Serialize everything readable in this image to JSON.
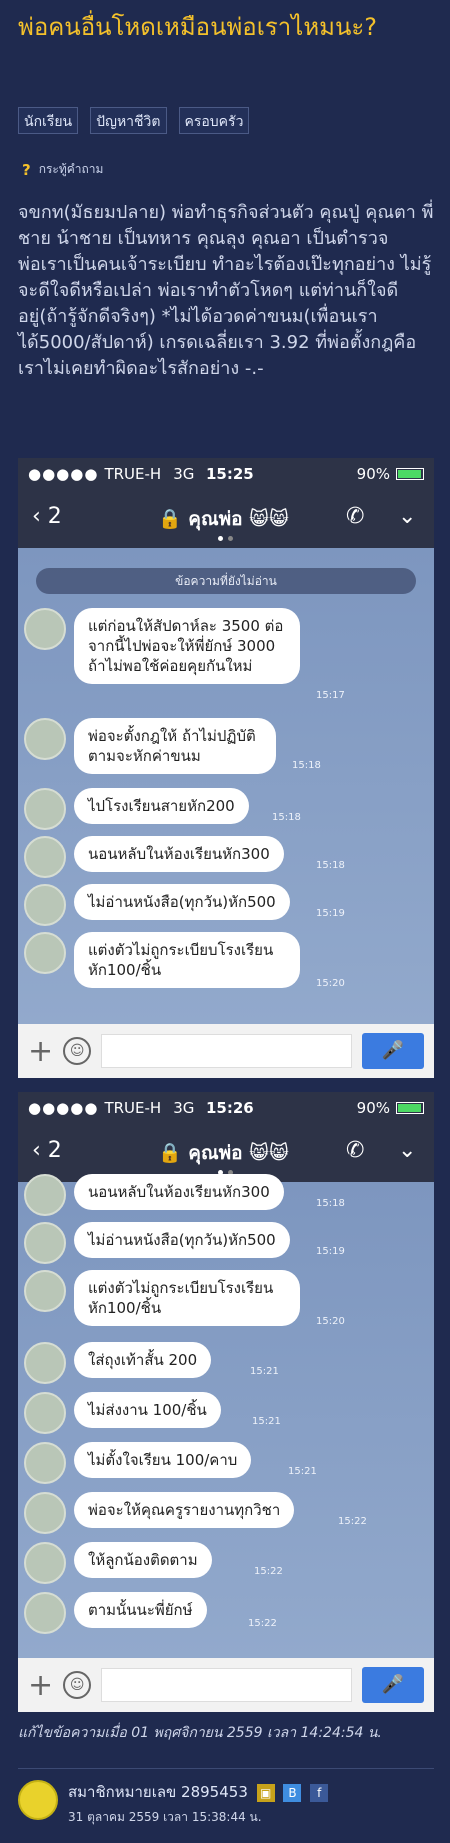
{
  "post": {
    "title": "พ่อคนอื่นโหดเหมือนพ่อเราไหมนะ?",
    "tags": [
      "นักเรียน",
      "ปัญหาชีวิต",
      "ครอบครัว"
    ],
    "type_label": "กระทู้คำถาม",
    "body": [
      "จขกท(มัธยมปลาย) พ่อทำธุรกิจส่วนตัว คุณปู่ คุณตา พี่ชาย น้าชาย เป็นทหาร คุณลุง คุณอา เป็นตำรวจ",
      "พ่อเราเป็นคนเจ้าระเบียบ ทำอะไรต้องเป๊ะทุกอย่าง ไม่รู้จะดีใจดีหรือเปล่า พ่อเราทำตัวโหดๆ แต่ท่านก็ใจดีอยู่(ถ้ารู้จักดีจริงๆ) *ไม่ได้อวดค่าขนม(เพื่อนเราได้5000/สัปดาห์) เกรดเฉลี่ยเรา 3.92 ที่พ่อตั้งกฎคือเราไม่เคยทำผิดอะไรสักอย่าง -.-"
    ],
    "edited": "แก้ไขข้อความเมื่อ 01 พฤศจิกายน 2559 เวลา 14:24:54 น.",
    "member": "สมาชิกหมายเลข 2895453",
    "posted": "31 ตุลาคม 2559 เวลา 15:38:44 น."
  },
  "screens": [
    {
      "carrier": "TRUE-H",
      "net": "3G",
      "time": "15:25",
      "battery": "90%",
      "back_count": "2",
      "contact": "คุณพ่อ 😸😸",
      "unread": "ข้อความที่ยังไม่อ่าน",
      "messages": [
        {
          "text": "แต่ก่อนให้สัปดาห์ละ 3500 ต่อจากนี้ไปพ่อจะให้พี่ยักษ์ 3000 ถ้าไม่พอใช้ค่อยคุยกันใหม่",
          "time": "15:17"
        },
        {
          "text": "พ่อจะตั้งกฎให้ ถ้าไม่ปฏิบัติตามจะหักค่าขนม",
          "time": "15:18"
        },
        {
          "text": "ไปโรงเรียนสายหัก200",
          "time": "15:18"
        },
        {
          "text": "นอนหลับในห้องเรียนหัก300",
          "time": "15:18"
        },
        {
          "text": "ไม่อ่านหนังสือ(ทุกวัน)หัก500",
          "time": "15:19"
        },
        {
          "text": "แต่งตัวไม่ถูกระเบียบโรงเรียนหัก100/ชิ้น",
          "time": "15:20"
        }
      ]
    },
    {
      "carrier": "TRUE-H",
      "net": "3G",
      "time": "15:26",
      "battery": "90%",
      "back_count": "2",
      "contact": "คุณพ่อ 😸😸",
      "messages": [
        {
          "text": "นอนหลับในห้องเรียนหัก300",
          "time": "15:18"
        },
        {
          "text": "ไม่อ่านหนังสือ(ทุกวัน)หัก500",
          "time": "15:19"
        },
        {
          "text": "แต่งตัวไม่ถูกระเบียบโรงเรียนหัก100/ชิ้น",
          "time": "15:20"
        },
        {
          "text": "ใส่ถุงเท้าสั้น 200",
          "time": "15:21"
        },
        {
          "text": "ไม่ส่งงาน 100/ชิ้น",
          "time": "15:21"
        },
        {
          "text": "ไม่ตั้งใจเรียน 100/คาบ",
          "time": "15:21"
        },
        {
          "text": "พ่อจะให้คุณครูรายงานทุกวิชา",
          "time": "15:22"
        },
        {
          "text": "ให้ลูกน้องติดตาม",
          "time": "15:22"
        },
        {
          "text": "ตามนั้นนะพี่ยักษ์",
          "time": "15:22"
        }
      ]
    }
  ],
  "icons": {
    "question": "question-icon",
    "back": "chevron-left-icon",
    "lock": "lock-icon",
    "call": "phone-icon",
    "expand": "chevron-down-icon",
    "plus": "plus-icon",
    "emoji": "smile-icon",
    "mic": "mic-icon",
    "battery": "battery-icon"
  }
}
